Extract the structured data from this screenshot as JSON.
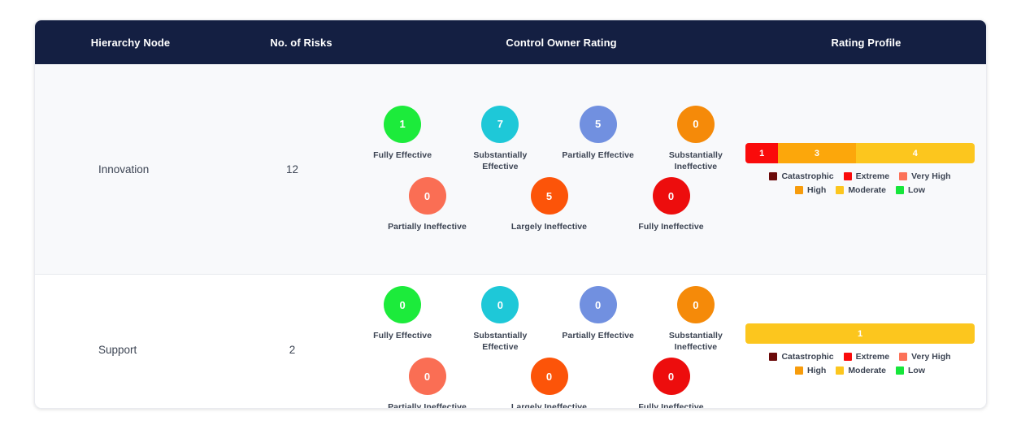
{
  "table": {
    "headers": {
      "hierarchy_node": "Hierarchy Node",
      "no_of_risks": "No. of Risks",
      "control_owner_rating": "Control Owner Rating",
      "rating_profile": "Rating Profile"
    },
    "header_bg": "#141f42",
    "rows": [
      {
        "node": "Innovation",
        "risks": "12",
        "control_owner_rating": [
          {
            "label": "Fully Effective",
            "value": "1",
            "color": "#1ceb3b"
          },
          {
            "label": "Substantially Effective",
            "value": "7",
            "color": "#1ec8d8"
          },
          {
            "label": "Partially Effective",
            "value": "5",
            "color": "#7190e0"
          },
          {
            "label": "Substantially Ineffective",
            "value": "0",
            "color": "#f58a09"
          },
          {
            "label": "Partially Ineffective",
            "value": "0",
            "color": "#fa6e54"
          },
          {
            "label": "Largely Ineffective",
            "value": "5",
            "color": "#fc5409"
          },
          {
            "label": "Fully Ineffective",
            "value": "0",
            "color": "#ed0d0d"
          }
        ],
        "rating_profile": {
          "segments": [
            {
              "label": "Extreme",
              "value": "1",
              "color": "#fa0b0b",
              "width_pct": 14.3
            },
            {
              "label": "High",
              "value": "3",
              "color": "#fca70b",
              "width_pct": 33.8
            },
            {
              "label": "Moderate",
              "value": "4",
              "color": "#fcc61e",
              "width_pct": 51.9
            }
          ]
        }
      },
      {
        "node": "Support",
        "risks": "2",
        "control_owner_rating": [
          {
            "label": "Fully Effective",
            "value": "0",
            "color": "#1ceb3b"
          },
          {
            "label": "Substantially Effective",
            "value": "0",
            "color": "#1ec8d8"
          },
          {
            "label": "Partially Effective",
            "value": "0",
            "color": "#7190e0"
          },
          {
            "label": "Substantially Ineffective",
            "value": "0",
            "color": "#f58a09"
          },
          {
            "label": "Partially Ineffective",
            "value": "0",
            "color": "#fa6e54"
          },
          {
            "label": "Largely Ineffective",
            "value": "0",
            "color": "#fc5409"
          },
          {
            "label": "Fully Ineffective",
            "value": "0",
            "color": "#ed0d0d"
          }
        ],
        "rating_profile": {
          "segments": [
            {
              "label": "Moderate",
              "value": "1",
              "color": "#fcc61e",
              "width_pct": 100
            }
          ]
        }
      }
    ]
  },
  "legend": [
    {
      "label": "Catastrophic",
      "color": "#6b0a0a"
    },
    {
      "label": "Extreme",
      "color": "#fa0b0b"
    },
    {
      "label": "Very High",
      "color": "#fc7259"
    },
    {
      "label": "High",
      "color": "#f79c0c"
    },
    {
      "label": "Moderate",
      "color": "#fcc61e"
    },
    {
      "label": "Low",
      "color": "#16e63a"
    }
  ],
  "chart_data": {
    "type": "bar",
    "title": "Rating Profile",
    "categories": [
      "Catastrophic",
      "Extreme",
      "Very High",
      "High",
      "Moderate",
      "Low"
    ],
    "series": [
      {
        "name": "Innovation",
        "values": [
          0,
          1,
          0,
          3,
          4,
          0
        ]
      },
      {
        "name": "Support",
        "values": [
          0,
          0,
          0,
          0,
          1,
          0
        ]
      }
    ],
    "xlabel": "",
    "ylabel": "",
    "legend_position": "bottom",
    "grid": false
  }
}
